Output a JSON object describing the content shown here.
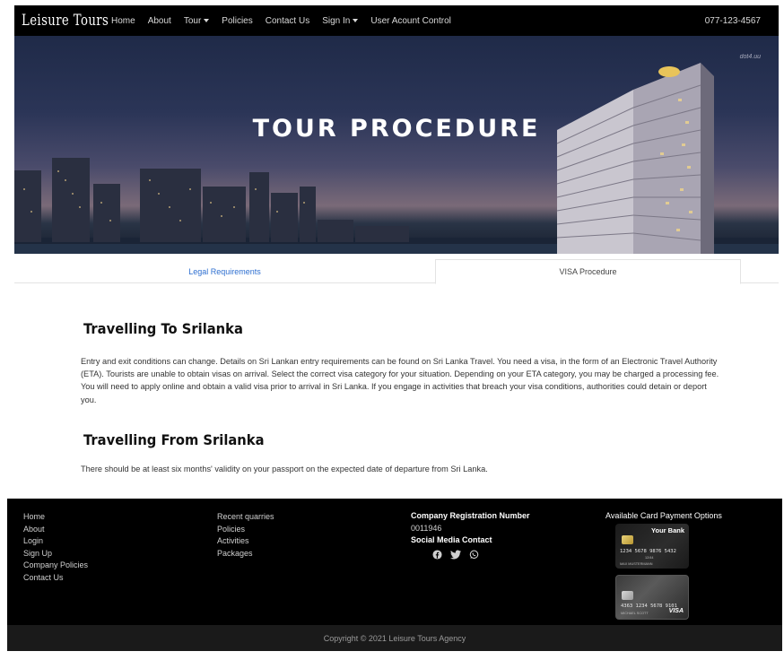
{
  "navbar": {
    "brand": "Leisure Tours",
    "items": [
      {
        "label": "Home"
      },
      {
        "label": "About"
      },
      {
        "label": "Tour"
      },
      {
        "label": "Policies"
      },
      {
        "label": "Contact Us"
      },
      {
        "label": "Sign In"
      },
      {
        "label": "User Acount Control"
      }
    ],
    "phone": "077-123-4567"
  },
  "hero": {
    "title": "TOUR PROCEDURE",
    "watermark": "dot4.uu"
  },
  "tabs": {
    "legal": "Legal Requirements",
    "visa": "VISA Procedure"
  },
  "content": {
    "to_title": "Travelling To Srilanka",
    "to_text": "Entry and exit conditions can change. Details on Sri Lankan entry requirements can be found on Sri Lanka Travel. You need a visa, in the form of an Electronic Travel Authority (ETA). Tourists are unable to obtain visas on arrival. Select the correct visa category for your situation. Depending on your ETA category, you may be charged a processing fee. You will need to apply online and obtain a valid visa prior to arrival in Sri Lanka. If you engage in activities that breach your visa conditions, authorities could detain or deport you.",
    "from_title": "Travelling From Srilanka",
    "from_text": "There should be at least six months' validity on your passport on the expected date of departure from Sri Lanka."
  },
  "footer": {
    "col1": [
      "Home",
      "About",
      "Login",
      "Sign Up",
      "Company Policies",
      "Contact Us"
    ],
    "col2": [
      "Recent quarries",
      "Policies",
      "Activities",
      "Packages"
    ],
    "reg_heading": "Company Registration Number",
    "reg_number": "0011946",
    "social_heading": "Social Media Contact",
    "social_icons": [
      "facebook-icon",
      "twitter-icon",
      "whatsapp-icon"
    ],
    "cards_heading": "Available Card Payment Options",
    "card1": {
      "bank": "Your Bank",
      "number": "1234 5678 9876 5432",
      "expiry": "12/44",
      "holder": "MAX MUSTERMANN"
    },
    "card2": {
      "number": "4363 1234 5678 9101",
      "holder": "MICHAEL SCOTT",
      "brand": "VISA"
    },
    "copyright": "Copyright © 2021 Leisure Tours Agency"
  },
  "colors": {
    "navbar_bg": "#000000",
    "link_blue": "#2e6fd0",
    "footer_bg": "#000000",
    "copyright_bg": "#1a1a1a"
  }
}
